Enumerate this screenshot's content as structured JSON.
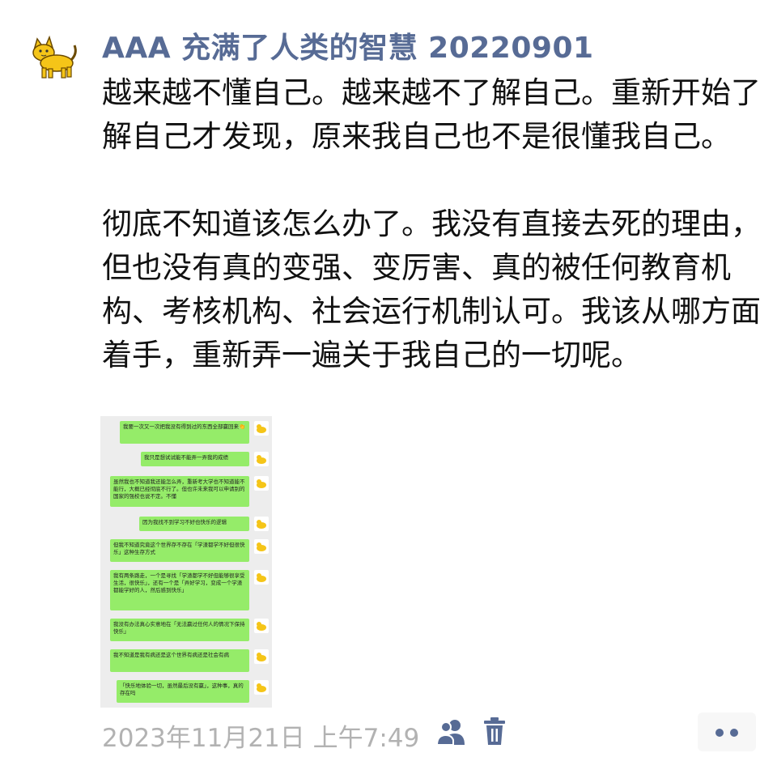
{
  "post": {
    "author": "AAA 充满了人类的智慧 20220901",
    "paragraphs": [
      "越来越不懂自己。越来越不了解自己。重新开始了解自己才发现，原来我自己也不是很懂我自己。",
      "彻底不知道该怎么办了。我没有直接去死的理由，但也没有真的变强、变厉害、真的被任何教育机构、考核机构、社会运行机制认可。我该从哪方面着手，重新弄一遍关于我自己的一切呢。"
    ],
    "timestamp": "2023年11月21日 上午7:49"
  },
  "thumbnail": {
    "messages": [
      "我要一次又一次把我没有得到过的东西全部赢回来👏",
      "我只是想试试能不能弄一弄我的成绩",
      "虽然我也不知道我还能怎么弄，重新考大学也不知道能不能行，大概已经彻底不行了。但也许未来我可以申请别的国家的强校也说不定。不懂",
      "因为我找不到学习不好也快乐的逻辑",
      "但我不知道究竟这个世界存不存在「学渣都学不好但很快乐」这种生存方式",
      "我有两条路走，一个是寻找「学渣都学不好但能够很享受生活，很快乐」，还有一个是「弄好学习，变成一个学渣都能学好的人，然后感到快乐」",
      "我没有办法真心实意地在「无法赢过任何人的情况下保持快乐」",
      "我不知道是我有病还是这个世界有病还是社会有病",
      "「快乐地体验一切，虽然最后没有赢」，这种事，真的存在吗"
    ]
  },
  "colors": {
    "author": "#576b95",
    "timestamp": "#b2b2b2",
    "bubble": "#95ec69",
    "icon": "#576b95"
  },
  "icons": {
    "avatar": "cat-avatar-icon",
    "visibility": "people-icon",
    "delete": "trash-icon",
    "more": "more-dots-icon"
  }
}
